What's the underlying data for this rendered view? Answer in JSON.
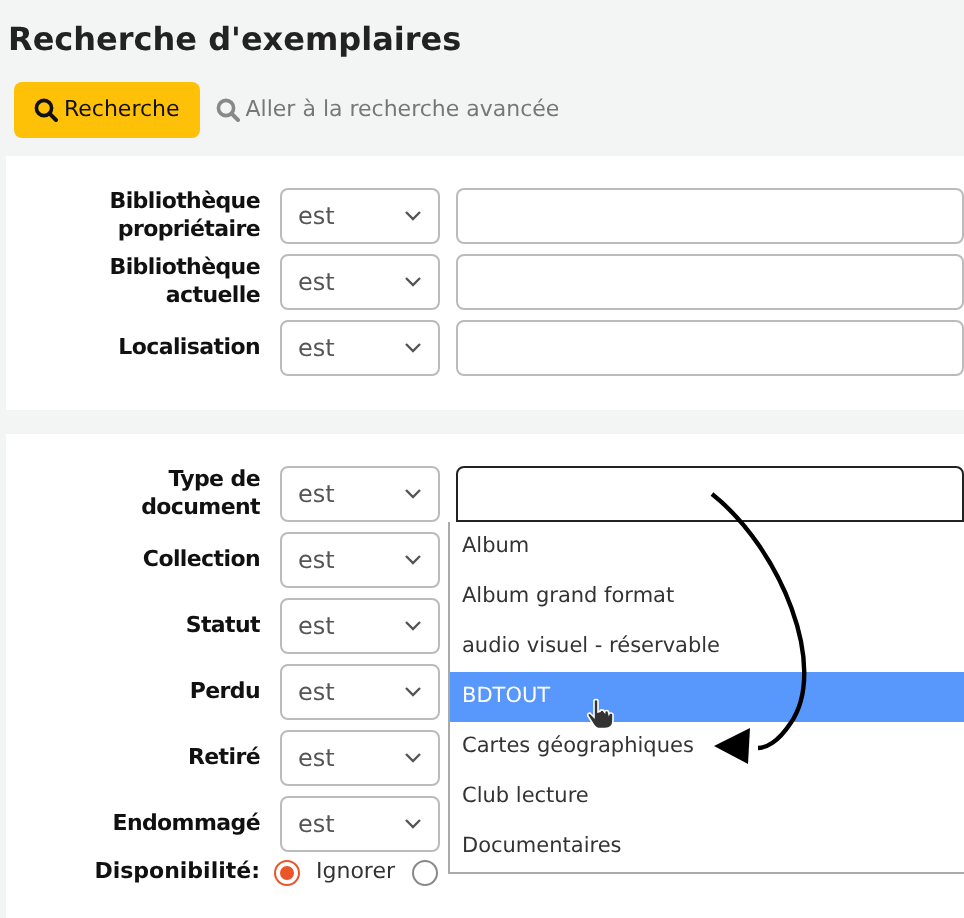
{
  "title": "Recherche d'exemplaires",
  "toolbar": {
    "search_button": "Recherche",
    "advanced_link": "Aller à la recherche avancée"
  },
  "panel_1": [
    {
      "label": "Bibliothèque propriétaire",
      "operator": "est"
    },
    {
      "label": "Bibliothèque actuelle",
      "operator": "est"
    },
    {
      "label": "Localisation",
      "operator": "est"
    }
  ],
  "panel_2": [
    {
      "label": "Type de document",
      "operator": "est",
      "dropdown": {
        "open": true,
        "options": [
          {
            "label": "Album",
            "selected": false
          },
          {
            "label": "Album grand format",
            "selected": false
          },
          {
            "label": "audio visuel - réservable",
            "selected": false
          },
          {
            "label": "BDTOUT",
            "selected": true
          },
          {
            "label": "Cartes géographiques",
            "selected": false
          },
          {
            "label": "Club lecture",
            "selected": false
          },
          {
            "label": "Documentaires",
            "selected": false
          }
        ]
      }
    },
    {
      "label": "Collection",
      "operator": "est"
    },
    {
      "label": "Statut",
      "operator": "est"
    },
    {
      "label": "Perdu",
      "operator": "est"
    },
    {
      "label": "Retiré",
      "operator": "est"
    },
    {
      "label": "Endommagé",
      "operator": "est"
    }
  ],
  "availability": {
    "label": "Disponibilité:",
    "options": [
      {
        "label": "Ignorer",
        "selected": true
      },
      {
        "selected": false
      }
    ]
  }
}
